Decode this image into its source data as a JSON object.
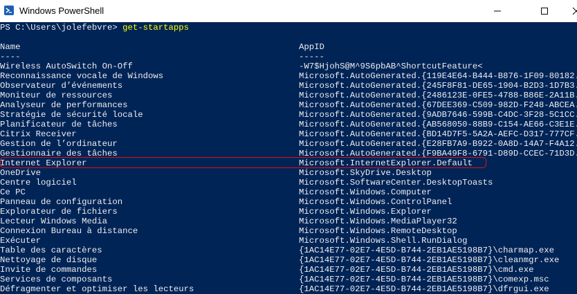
{
  "window": {
    "title": "Windows PowerShell",
    "icon": "powershell-icon",
    "controls": [
      "minimize-icon",
      "maximize-icon",
      "close-icon"
    ]
  },
  "console": {
    "prompt": "PS C:\\Users\\jolefebvre>",
    "command": "get-startapps",
    "header": {
      "name": "Name",
      "appid": "AppID"
    },
    "separator": {
      "name": "----",
      "appid": "-----"
    },
    "colors": {
      "background": "#012456",
      "text": "#eeedf0",
      "command": "#ffff00",
      "highlight": "#e01010"
    },
    "rows": [
      {
        "name": "Wireless AutoSwitch On-Off",
        "appid": "-W7$HjohS@M^9S6pbAB^ShortcutFeature<"
      },
      {
        "name": "Reconnaissance vocale de Windows",
        "appid": "Microsoft.AutoGenerated.{119E4E64-B444-B876-1F09-80182..."
      },
      {
        "name": "Observateur d’événements",
        "appid": "Microsoft.AutoGenerated.{245F8F81-DE65-1904-B2D3-1D7B3..."
      },
      {
        "name": "Moniteur de ressources",
        "appid": "Microsoft.AutoGenerated.{2486123E-0FE5-4788-B86E-2A11B..."
      },
      {
        "name": "Analyseur de performances",
        "appid": "Microsoft.AutoGenerated.{67DEE369-C509-982D-F248-ABCEA..."
      },
      {
        "name": "Stratégie de sécurité locale",
        "appid": "Microsoft.AutoGenerated.{9ADB7646-599B-C4DC-3F28-5C1CC..."
      },
      {
        "name": "Planificateur de tâches",
        "appid": "Microsoft.AutoGenerated.{AB568050-88B9-C154-AE66-C3E1E..."
      },
      {
        "name": "Citrix Receiver",
        "appid": "Microsoft.AutoGenerated.{BD14D7F5-5A2A-AEFC-D317-777CF..."
      },
      {
        "name": "Gestion de l’ordinateur",
        "appid": "Microsoft.AutoGenerated.{E28FB7A9-B922-0A8D-14A7-F4A12..."
      },
      {
        "name": "Gestionnaire des tâches",
        "appid": "Microsoft.AutoGenerated.{F9BA49F8-6791-D89D-CCEC-71D3D..."
      },
      {
        "name": "Internet Explorer",
        "appid": "Microsoft.InternetExplorer.Default"
      },
      {
        "name": "OneDrive",
        "appid": "Microsoft.SkyDrive.Desktop"
      },
      {
        "name": "Centre logiciel",
        "appid": "Microsoft.SoftwareCenter.DesktopToasts"
      },
      {
        "name": "Ce PC",
        "appid": "Microsoft.Windows.Computer"
      },
      {
        "name": "Panneau de configuration",
        "appid": "Microsoft.Windows.ControlPanel"
      },
      {
        "name": "Explorateur de fichiers",
        "appid": "Microsoft.Windows.Explorer"
      },
      {
        "name": "Lecteur Windows Media",
        "appid": "Microsoft.Windows.MediaPlayer32"
      },
      {
        "name": "Connexion Bureau à distance",
        "appid": "Microsoft.Windows.RemoteDesktop"
      },
      {
        "name": "Exécuter",
        "appid": "Microsoft.Windows.Shell.RunDialog"
      },
      {
        "name": "Table des caractères",
        "appid": "{1AC14E77-02E7-4E5D-B744-2EB1AE5198B7}\\charmap.exe"
      },
      {
        "name": "Nettoyage de disque",
        "appid": "{1AC14E77-02E7-4E5D-B744-2EB1AE5198B7}\\cleanmgr.exe"
      },
      {
        "name": "Invite de commandes",
        "appid": "{1AC14E77-02E7-4E5D-B744-2EB1AE5198B7}\\cmd.exe"
      },
      {
        "name": "Services de composants",
        "appid": "{1AC14E77-02E7-4E5D-B744-2EB1AE5198B7}\\comexp.msc"
      },
      {
        "name": "Défragmenter et optimiser les lecteurs",
        "appid": "{1AC14E77-02E7-4E5D-B744-2EB1AE5198B7}\\dfrgui.exe"
      }
    ]
  }
}
